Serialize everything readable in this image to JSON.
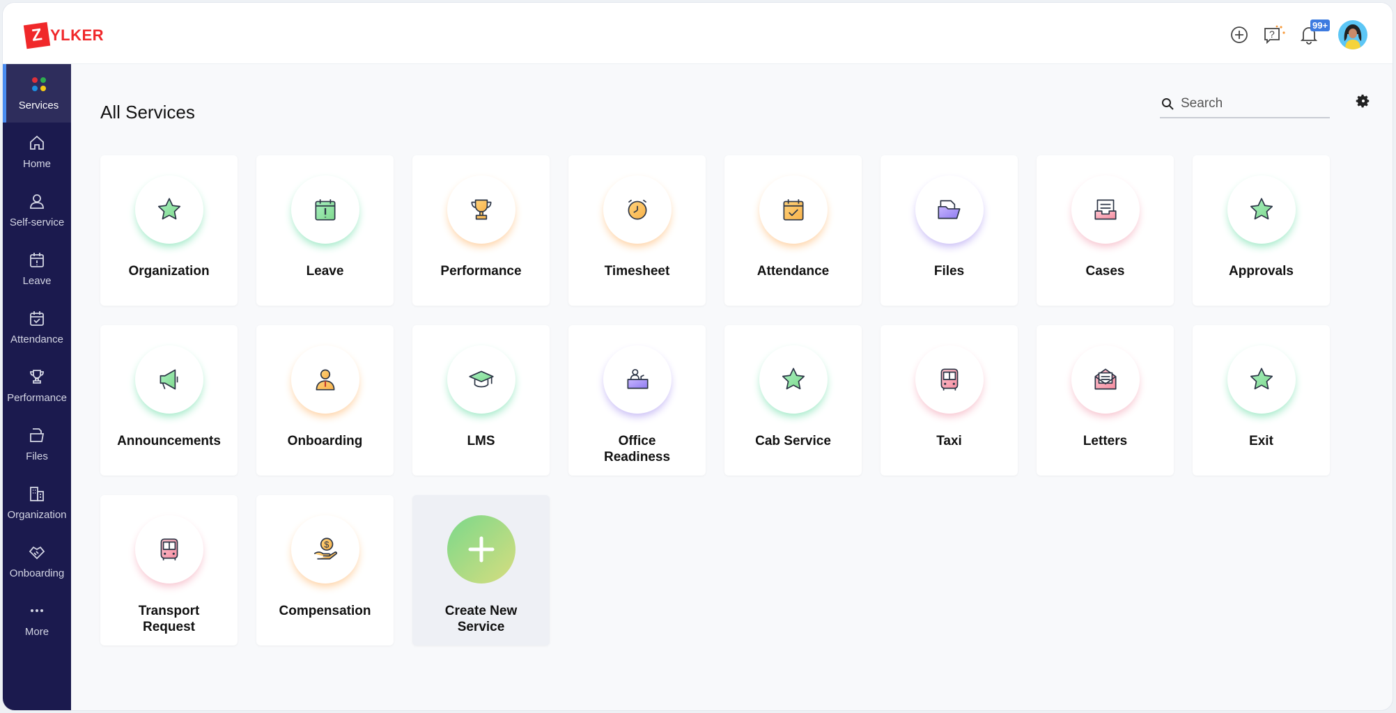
{
  "header": {
    "logo_letter": "Z",
    "logo_text": "YLKER",
    "notification_count": "99+"
  },
  "sidebar": {
    "items": [
      {
        "label": "Services",
        "icon": "services-dots-icon",
        "active": true
      },
      {
        "label": "Home",
        "icon": "home-icon"
      },
      {
        "label": "Self-service",
        "icon": "user-icon"
      },
      {
        "label": "Leave",
        "icon": "calendar-alert-icon"
      },
      {
        "label": "Attendance",
        "icon": "calendar-check-icon"
      },
      {
        "label": "Performance",
        "icon": "trophy-icon"
      },
      {
        "label": "Files",
        "icon": "folder-icon"
      },
      {
        "label": "Organization",
        "icon": "building-icon"
      },
      {
        "label": "Onboarding",
        "icon": "handshake-icon"
      },
      {
        "label": "More",
        "icon": "more-icon"
      }
    ]
  },
  "main": {
    "title": "All Services",
    "search_placeholder": "Search",
    "services": [
      {
        "label": "Organization",
        "icon": "star",
        "glow": "#9be8c4"
      },
      {
        "label": "Leave",
        "icon": "cal-alert",
        "glow": "#9be8c4"
      },
      {
        "label": "Performance",
        "icon": "trophy",
        "glow": "#ffcf9e"
      },
      {
        "label": "Timesheet",
        "icon": "clock",
        "glow": "#ffcf9e"
      },
      {
        "label": "Attendance",
        "icon": "cal-check",
        "glow": "#ffcf9e"
      },
      {
        "label": "Files",
        "icon": "folder",
        "glow": "#c5b8f5"
      },
      {
        "label": "Cases",
        "icon": "inbox",
        "glow": "#f7c0cc"
      },
      {
        "label": "Approvals",
        "icon": "star",
        "glow": "#9be8c4"
      },
      {
        "label": "Announcements",
        "icon": "megaphone",
        "glow": "#9be8c4"
      },
      {
        "label": "Onboarding",
        "icon": "person",
        "glow": "#ffcf9e"
      },
      {
        "label": "LMS",
        "icon": "cap",
        "glow": "#9be8c4"
      },
      {
        "label": "Office Readiness",
        "icon": "desk",
        "glow": "#c5b8f5"
      },
      {
        "label": "Cab Service",
        "icon": "star",
        "glow": "#9be8c4"
      },
      {
        "label": "Taxi",
        "icon": "bus",
        "glow": "#f7c0cc"
      },
      {
        "label": "Letters",
        "icon": "mail",
        "glow": "#f7c0cc"
      },
      {
        "label": "Exit",
        "icon": "star",
        "glow": "#9be8c4"
      },
      {
        "label": "Transport Request",
        "icon": "bus",
        "glow": "#f7c0cc"
      },
      {
        "label": "Compensation",
        "icon": "coin",
        "glow": "#ffcf9e"
      }
    ],
    "create_label": "Create New Service"
  },
  "colors": {
    "sidebar": "#1b1a4e",
    "accent": "#4a8cf0",
    "brand": "#f0282a"
  }
}
